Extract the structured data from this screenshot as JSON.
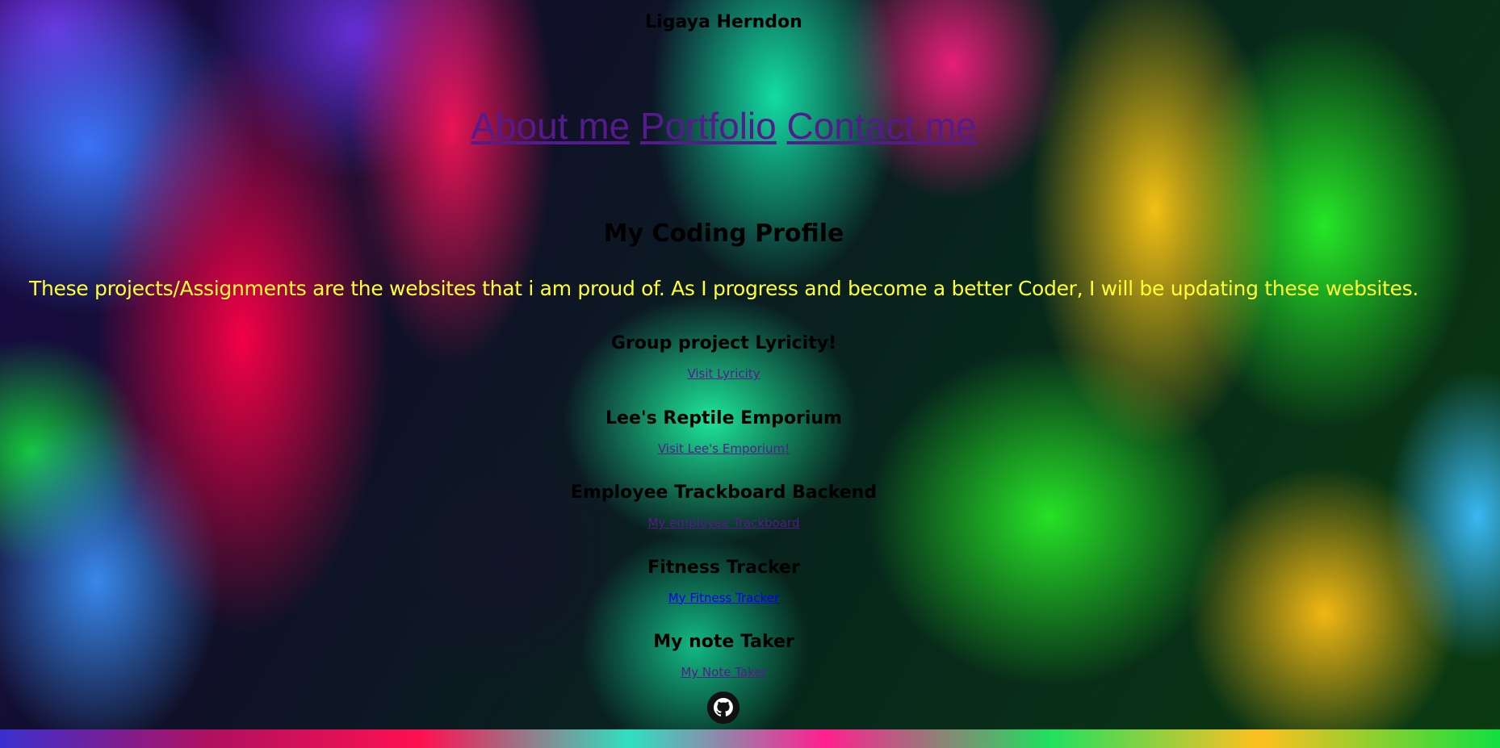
{
  "header": {
    "name": "Ligaya Herndon"
  },
  "nav": {
    "items": [
      {
        "label": "About me"
      },
      {
        "label": "Portfolio"
      },
      {
        "label": "Contact me"
      }
    ]
  },
  "main": {
    "title": "My Coding Profile",
    "intro": "These projects/Assignments are the websites that i am proud of. As I progress and become a better Coder, I will be updating these websites.",
    "projects": [
      {
        "title": "Group project Lyricity!",
        "link_label": "Visit Lyricity"
      },
      {
        "title": "Lee's Reptile Emporium",
        "link_label": "Visit Lee's Emporium!"
      },
      {
        "title": "Employee Trackboard Backend",
        "link_label": "My employee Trackboard"
      },
      {
        "title": "Fitness Tracker",
        "link_label": "My Fitness Tracker"
      },
      {
        "title": "My note Taker",
        "link_label": "My Note Taker"
      }
    ]
  },
  "footer": {
    "github_icon": "github-icon"
  },
  "colors": {
    "intro_text": "#ffff33",
    "visited_link": "#551a8b",
    "unvisited_link": "#0000ee"
  }
}
